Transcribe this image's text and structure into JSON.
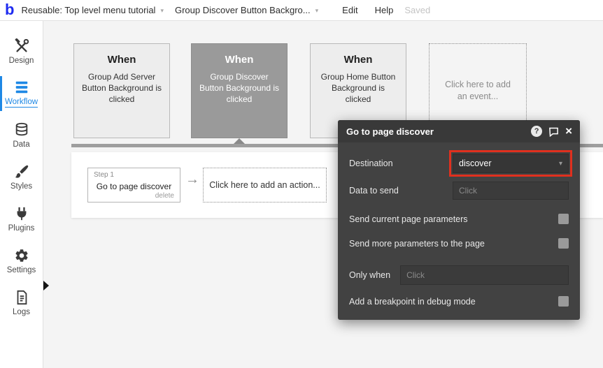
{
  "topbar": {
    "logo_text": "b",
    "project_menu": "Reusable: Top level menu tutorial",
    "element_menu": "Group Discover Button Backgro...",
    "edit_label": "Edit",
    "help_label": "Help",
    "saved_label": "Saved"
  },
  "sidebar": {
    "items": [
      {
        "label": "Design",
        "icon": "design-tools-icon"
      },
      {
        "label": "Workflow",
        "icon": "workflow-icon"
      },
      {
        "label": "Data",
        "icon": "database-icon"
      },
      {
        "label": "Styles",
        "icon": "paintbrush-icon"
      },
      {
        "label": "Plugins",
        "icon": "plug-icon"
      },
      {
        "label": "Settings",
        "icon": "gear-icon"
      },
      {
        "label": "Logs",
        "icon": "document-icon"
      }
    ]
  },
  "canvas": {
    "events": [
      {
        "title": "When",
        "description": "Group Add Server Button Background is clicked",
        "selected": false
      },
      {
        "title": "When",
        "description": "Group Discover Button Background is clicked",
        "selected": true
      },
      {
        "title": "When",
        "description": "Group Home Button Background is clicked",
        "selected": false
      }
    ],
    "add_event_label": "Click here to add an event...",
    "step": {
      "number_label": "Step 1",
      "title": "Go to page discover",
      "delete_label": "delete"
    },
    "add_action_label": "Click here to add an action..."
  },
  "popup": {
    "title": "Go to page discover",
    "destination_label": "Destination",
    "destination_value": "discover",
    "data_to_send_label": "Data to send",
    "data_to_send_placeholder": "Click",
    "send_current_params_label": "Send current page parameters",
    "send_more_params_label": "Send more parameters to the page",
    "only_when_label": "Only when",
    "only_when_placeholder": "Click",
    "breakpoint_label": "Add a breakpoint in debug mode"
  },
  "icons": {
    "chevron_down": "▾",
    "arrow_right": "→",
    "close": "×",
    "question": "?"
  },
  "colors": {
    "brand_blue": "#1e2bf0",
    "active_nav_blue": "#1e88e5",
    "highlight_red": "#e0301e",
    "selected_event_gray": "#9a9a9a",
    "popup_bg": "#424242"
  }
}
